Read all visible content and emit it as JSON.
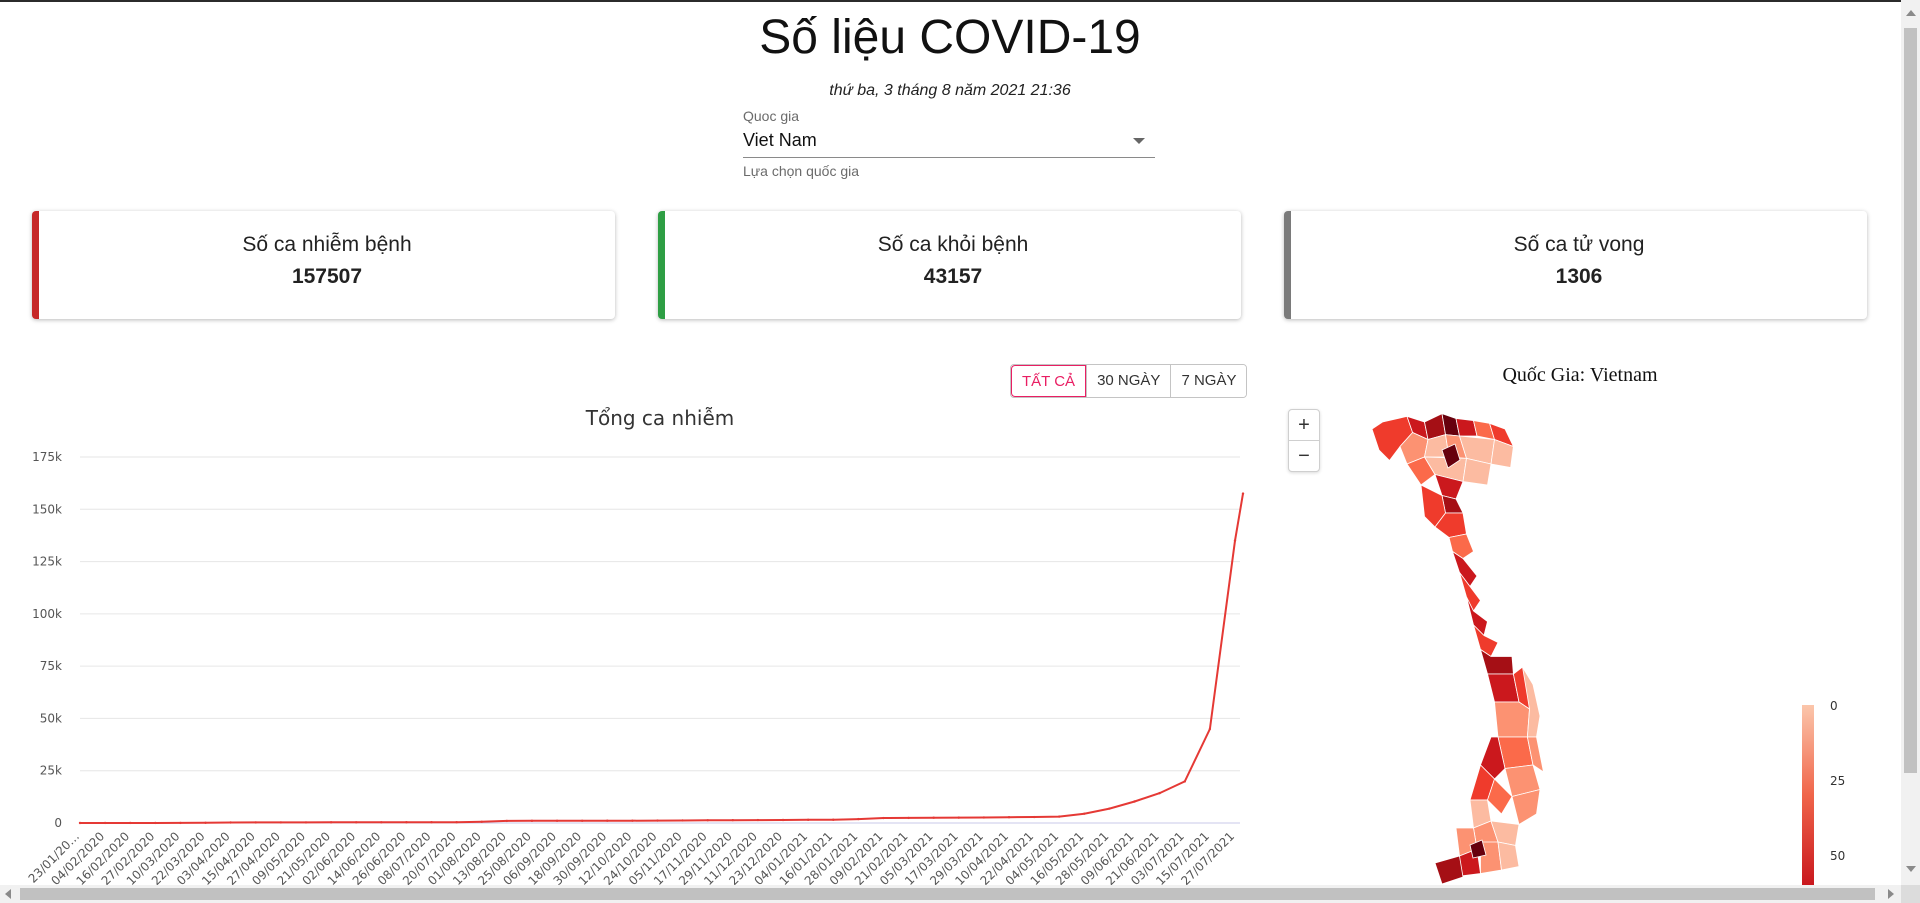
{
  "page": {
    "title": "Số liệu COVID-19",
    "date": "thứ ba, 3 tháng 8 năm 2021 21:36"
  },
  "country_select": {
    "label": "Quoc gia",
    "value": "Viet Nam",
    "helper": "Lựa chọn quốc gia"
  },
  "stats": {
    "infected": {
      "label": "Số ca nhiễm bệnh",
      "value": "157507",
      "color": "#c62828"
    },
    "recovered": {
      "label": "Số ca khỏi bệnh",
      "value": "43157",
      "color": "#2e9e44"
    },
    "deaths": {
      "label": "Số ca tử vong",
      "value": "1306",
      "color": "#7a7a7a"
    }
  },
  "range_buttons": {
    "all": "TẤT CẢ",
    "days30": "30 NGÀY",
    "days7": "7 NGÀY",
    "active": "all"
  },
  "chart_data": {
    "type": "line",
    "title": "Tổng ca nhiễm",
    "xlabel": "",
    "ylabel": "",
    "ylim": [
      0,
      175000
    ],
    "yticks": [
      "0",
      "25k",
      "50k",
      "75k",
      "100k",
      "125k",
      "150k",
      "175k"
    ],
    "grid": true,
    "line_color": "#e53935",
    "x": [
      "23/01/20…",
      "04/02/2020",
      "16/02/2020",
      "27/02/2020",
      "10/03/2020",
      "22/03/2020",
      "03/04/2020",
      "15/04/2020",
      "27/04/2020",
      "09/05/2020",
      "21/05/2020",
      "02/06/2020",
      "14/06/2020",
      "26/06/2020",
      "08/07/2020",
      "20/07/2020",
      "01/08/2020",
      "13/08/2020",
      "25/08/2020",
      "06/09/2020",
      "18/09/2020",
      "30/09/2020",
      "12/10/2020",
      "24/10/2020",
      "05/11/2020",
      "17/11/2020",
      "29/11/2020",
      "11/12/2020",
      "23/12/2020",
      "04/01/2021",
      "16/01/2021",
      "28/01/2021",
      "09/02/2021",
      "21/02/2021",
      "05/03/2021",
      "17/03/2021",
      "29/03/2021",
      "10/04/2021",
      "22/04/2021",
      "04/05/2021",
      "16/05/2021",
      "28/05/2021",
      "09/06/2021",
      "21/06/2021",
      "03/07/2021",
      "15/07/2021",
      "27/07/2021"
    ],
    "series": [
      {
        "values": [
          2,
          10,
          16,
          16,
          35,
          113,
          237,
          268,
          270,
          288,
          324,
          328,
          334,
          355,
          369,
          383,
          590,
          990,
          1036,
          1060,
          1068,
          1096,
          1107,
          1169,
          1216,
          1307,
          1347,
          1405,
          1440,
          1513,
          1551,
          1863,
          2376,
          2426,
          2527,
          2575,
          2631,
          2773,
          2852,
          3063,
          4456,
          6908,
          10286,
          14284,
          19870,
          44952,
          135000
        ]
      }
    ],
    "end_point": {
      "x": "03/08/2021",
      "value": 157507
    }
  },
  "map": {
    "title": "Quốc Gia: Vietnam",
    "zoom_in": "+",
    "zoom_out": "−",
    "legend": {
      "labels": [
        "0",
        "25",
        "50"
      ],
      "colors": [
        "#fbc6ab",
        "#f0654a",
        "#c9181e"
      ]
    },
    "palette": [
      "#fcbba1",
      "#fc9272",
      "#fb6a4a",
      "#ef3b2c",
      "#cb181d",
      "#a50f15",
      "#67000d"
    ]
  }
}
